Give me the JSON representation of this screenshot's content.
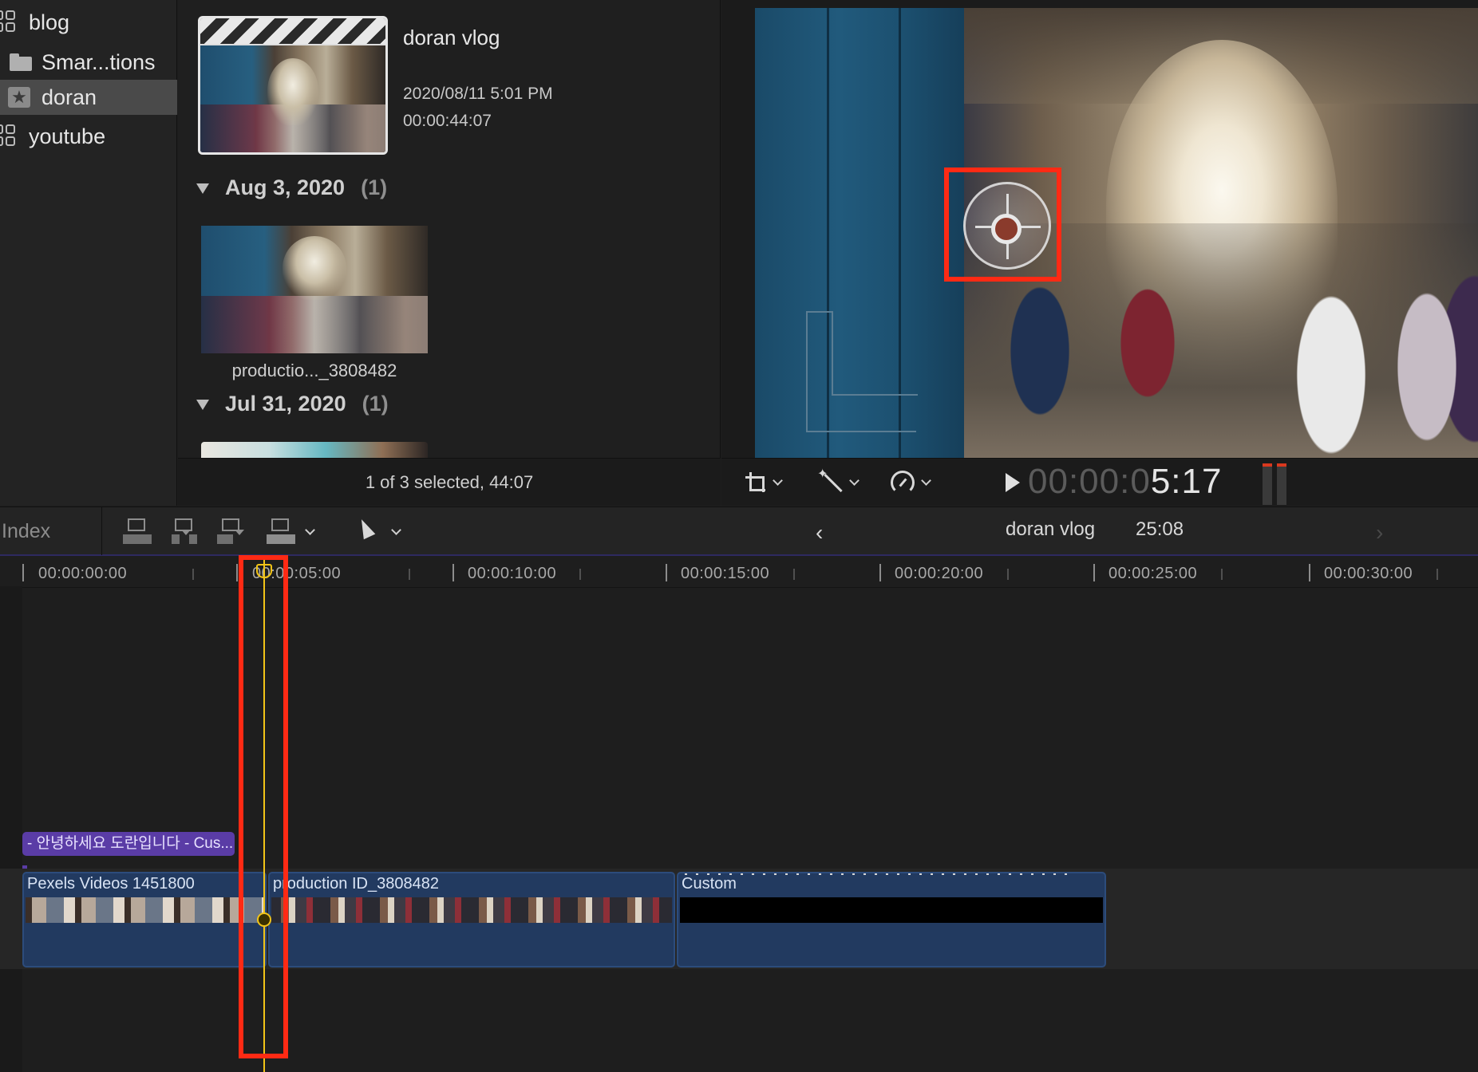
{
  "sidebar": {
    "items": [
      {
        "label": "blog",
        "icon": "library-grid-icon",
        "selected": false
      },
      {
        "label": "Smar...tions",
        "icon": "folder-icon",
        "selected": false
      },
      {
        "label": "doran",
        "icon": "star-event-icon",
        "selected": true
      },
      {
        "label": "youtube",
        "icon": "library-grid-icon",
        "selected": false
      }
    ]
  },
  "browser": {
    "selected_clip": {
      "title": "doran vlog",
      "date": "2020/08/11 5:01 PM",
      "duration": "00:00:44:07"
    },
    "groups": [
      {
        "date": "Aug 3, 2020",
        "count": "(1)",
        "clip_name": "productio..._3808482"
      },
      {
        "date": "Jul 31, 2020",
        "count": "(1)"
      }
    ],
    "status": "1 of 3 selected, 44:07"
  },
  "viewer": {
    "timecode_dim": "00:00:0",
    "timecode_lit": "5:17",
    "accent_overlay": "#ff2a14"
  },
  "timeline_toolbar": {
    "index_label": "Index",
    "project_name": "doran vlog",
    "project_duration": "25:08",
    "back_icon": "‹",
    "forward_icon": "›"
  },
  "timeline": {
    "ruler_labels": [
      "00:00:00:00",
      "00:00:05:00",
      "00:00:10:00",
      "00:00:15:00",
      "00:00:20:00",
      "00:00:25:00",
      "00:00:30:00"
    ],
    "title_clip": "- 안녕하세요 도란입니다 - Cus...",
    "clips": [
      {
        "name": "Pexels Videos 1451800"
      },
      {
        "name": "production ID_3808482"
      },
      {
        "name": "Custom"
      }
    ],
    "playhead_color": "#f2c417",
    "highlight_color": "#ff2a14"
  }
}
